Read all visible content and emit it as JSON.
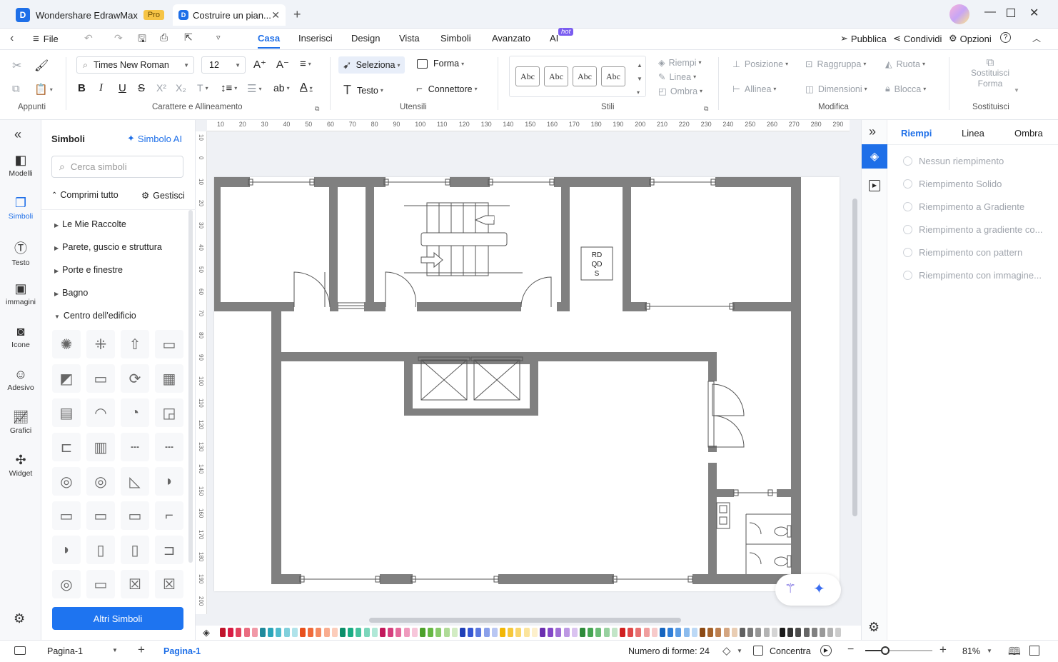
{
  "window": {
    "app_tab_title": "Wondershare EdrawMax",
    "pro_badge": "Pro",
    "doc_tab_title": "Costruire un pian...",
    "new_tab_icon": "plus-icon"
  },
  "menu": {
    "file_label": "File",
    "tabs": [
      "Casa",
      "Inserisci",
      "Design",
      "Vista",
      "Simboli",
      "Avanzato",
      "AI"
    ],
    "active_tab": "Casa",
    "ai_badge": "hot",
    "publish_label": "Pubblica",
    "share_label": "Condividi",
    "options_label": "Opzioni"
  },
  "ribbon": {
    "groups": {
      "clipboard": "Appunti",
      "font": "Carattere e Allineamento",
      "tools": "Utensili",
      "styles": "Stili",
      "modify": "Modifica",
      "replace": "Sostituisci"
    },
    "font_name": "Times New Roman",
    "font_size": "12",
    "select_label": "Seleziona",
    "shape_label": "Forma",
    "text_label": "Testo",
    "connector_label": "Connettore",
    "style_swatch_label": "Abc",
    "fill_label": "Riempi",
    "line_label": "Linea",
    "shadow_label": "Ombra",
    "position_label": "Posizione",
    "group_label": "Raggruppa",
    "rotate_label": "Ruota",
    "align_label": "Allinea",
    "size_label": "Dimensioni",
    "lock_label": "Blocca",
    "replace_shape_line1": "Sostituisci",
    "replace_shape_line2": "Forma"
  },
  "leftbar": {
    "items": [
      {
        "label": "Modelli",
        "icon": "templates-icon"
      },
      {
        "label": "Simboli",
        "icon": "symbols-icon"
      },
      {
        "label": "Testo",
        "icon": "text-icon"
      },
      {
        "label": "immagini",
        "icon": "image-icon"
      },
      {
        "label": "Icone",
        "icon": "icons-icon"
      },
      {
        "label": "Adesivo",
        "icon": "sticker-icon"
      },
      {
        "label": "Grafici",
        "icon": "chart-icon"
      },
      {
        "label": "Widget",
        "icon": "widget-icon"
      }
    ],
    "active": "Simboli"
  },
  "symbols_panel": {
    "title": "Simboli",
    "ai_link": "Simbolo AI",
    "search_placeholder": "Cerca simboli",
    "collapse_all": "Comprimi tutto",
    "manage": "Gestisci",
    "categories": [
      "Le Mie Raccolte",
      "Parete, guscio e struttura",
      "Porte e finestre",
      "Bagno",
      "Centro dell'edificio"
    ],
    "expanded_category": "Centro dell'edificio",
    "more_button": "Altri Simboli"
  },
  "canvas": {
    "ruler_h": [
      "10",
      "20",
      "30",
      "40",
      "50",
      "60",
      "70",
      "80",
      "90",
      "100",
      "110",
      "120",
      "130",
      "140",
      "150",
      "160",
      "170",
      "180",
      "190",
      "200",
      "210",
      "220",
      "230",
      "240",
      "250",
      "260",
      "270",
      "280",
      "290"
    ],
    "ruler_v": [
      "10",
      "0",
      "10",
      "20",
      "30",
      "40",
      "50",
      "60",
      "70",
      "80",
      "90",
      "100",
      "110",
      "120",
      "130",
      "140",
      "150",
      "160",
      "170",
      "180",
      "190",
      "200"
    ],
    "label_box": [
      "RD",
      "QD",
      "S"
    ]
  },
  "right_panel": {
    "tabs": [
      "Riempi",
      "Linea",
      "Ombra"
    ],
    "active_tab": "Riempi",
    "fill_options": [
      "Nessun riempimento",
      "Riempimento Solido",
      "Riempimento a Gradiente",
      "Riempimento a gradiente co...",
      "Riempimento con pattern",
      "Riempimento con immagine..."
    ]
  },
  "palette": {
    "colors": [
      "#c0142b",
      "#d81b43",
      "#e2435d",
      "#ea6c80",
      "#f199a7",
      "#1f8a9c",
      "#2aa6ba",
      "#50bccd",
      "#80d0dc",
      "#b0e3ea",
      "#e8501c",
      "#f06a3a",
      "#f58a62",
      "#f9ac8f",
      "#fccdbb",
      "#0b8f6a",
      "#19ad84",
      "#46c39f",
      "#7bd6bb",
      "#b0e8d7",
      "#c2185b",
      "#d63f7e",
      "#e56b9c",
      "#ef9abd",
      "#f7c6da",
      "#4ca12a",
      "#66b844",
      "#8acb6c",
      "#afdb97",
      "#d2ecc3",
      "#1f3fb8",
      "#3556d4",
      "#5b78e0",
      "#8aa0ea",
      "#b9c7f3",
      "#f2b705",
      "#f6c83a",
      "#f9d76c",
      "#fbe49c",
      "#fdf0cc",
      "#6b2fb0",
      "#8448c8",
      "#a06fd6",
      "#bd98e3",
      "#dac3f0",
      "#2e8b3a",
      "#46a653",
      "#6cbd77",
      "#97d19f",
      "#c2e5c7",
      "#d01f1f",
      "#e04848",
      "#e87272",
      "#f09e9e",
      "#f7caca",
      "#1565c0",
      "#2f7ed8",
      "#5b9ce4",
      "#8bbbed",
      "#bcd9f6",
      "#8c4a14",
      "#a5622a",
      "#bd8050",
      "#d4a580",
      "#e9cdb3",
      "#606060",
      "#7a7a7a",
      "#969696",
      "#b4b4b4",
      "#d4d4d4",
      "#1a1a1a",
      "#333333",
      "#4d4d4d",
      "#666666",
      "#808080",
      "#999999",
      "#b3b3b3",
      "#cccccc"
    ]
  },
  "status": {
    "page_selector": "Pagina-1",
    "page_tab": "Pagina-1",
    "shape_count": "Numero di forme: 24",
    "focus_label": "Concentra",
    "zoom": "81%",
    "zoom_fraction": 0.3
  }
}
